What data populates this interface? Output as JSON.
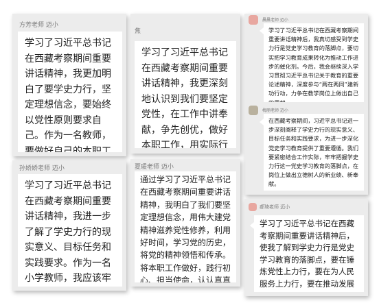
{
  "cards": [
    {
      "author": "方芳老师 迈小",
      "text": "学习了习近平总书记在西藏考察期间重要讲话精神，我更加明白了要学史力行，坚定理想信念，要始终以党性原则要求自己。作为一名教师，要做好自己的本职工作，求真务实，担当作为，培养好祖国的下一代。"
    },
    {
      "author": "焦",
      "text": "学习了习近平总书记在西藏考察期间重要讲话精神，我更深刻地认识到我们要坚定党性，在工作中讲奉献，争先创优，做好本职工作，用实际行动向党汇报。"
    },
    {
      "author": "晨晨老师 迈小",
      "text": "学习了习近平总书记在西藏考察期间重要讲话精神后，我真切感受到学史力行是党史学习教育的落脚点，要切实把学习教育成果转化为推动工作进步的催化剂。今后，我会继续深入学习贯彻习近平总书记关于教育的重要论述精神，深度参与“两在两同”建新功行动，力争在教学岗位上做出自己的贡献。"
    },
    {
      "author": "梅丽老师 迈小",
      "text": "在西藏考察期间，习近平总书记进一步深刻阐释了学史力行的现实意义、目标任务和实践要求，为进一步深化党史学习教育提供了重要遵循。我们要紧密结合工作实际，牢牢把握学史力行这一党史学习教育的落脚点，在岗位上做出立德树人的新业绩、新奉献。"
    },
    {
      "author": "孙娇娇老师 迈小",
      "text": "学习了习近平总书记在西藏考察期间重要讲话精神，我进一步了解了学史力行的现实意义、目标任务和实践要求。作为一名小学教师，我应该牢记立德树人、教书育人的使命，在教育教学岗位上贡献自己的力量。"
    },
    {
      "author": "夏瑗老师 迈小",
      "text": "通过学习了习近平总书记在西藏考察期间重要讲话精神，我明白了我们要坚定理想信念，用伟大建党精神滋养党性修养，利用好时间，学习党的历史，将党的精神领悟和传承。将本职工作做好，践行初心、担当使命，认认真真做好本职工作，不怕苦，不怕累。"
    },
    {
      "author": "郝琦老师 迈小",
      "text": "学习了习近平总书记在西藏考察期间重要讲话精神后，使我了解到学史力行是党史学习教育的落脚点，要在锤炼党性上力行，要在为人民服务上力行，要在推动发展上力行。"
    }
  ]
}
